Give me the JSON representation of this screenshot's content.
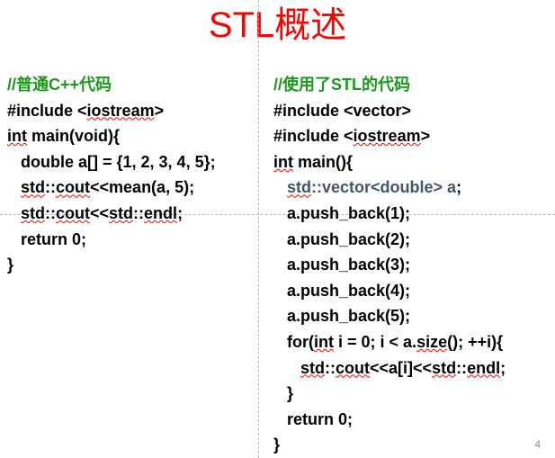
{
  "slide": {
    "title": "STL概述",
    "page_number": "4"
  },
  "left_code": {
    "lines": [
      "//普通C++代码",
      "#include <iostream>",
      "int main(void){",
      "   double a[] = {1, 2, 3, 4, 5};",
      "   std::cout<<mean(a, 5);",
      "   std::cout<<std::endl;",
      "   return 0;",
      "}"
    ]
  },
  "right_code": {
    "lines": [
      "//使用了STL的代码",
      "#include <vector>",
      "#include <iostream>",
      "int main(){",
      "   std::vector<double> a;",
      "   a.push_back(1);",
      "   a.push_back(2);",
      "   a.push_back(3);",
      "   a.push_back(4);",
      "   a.push_back(5);",
      "   for(int i = 0; i < a.size(); ++i){",
      "      std::cout<<a[i]<<std::endl;",
      "   }",
      "   return 0;",
      "}"
    ]
  },
  "colors": {
    "title": "#ff0000",
    "comment": "#1a9a1a",
    "type_declaration": "#44546a",
    "code": "#000000",
    "spellcheck_underline": "#ff0000"
  }
}
